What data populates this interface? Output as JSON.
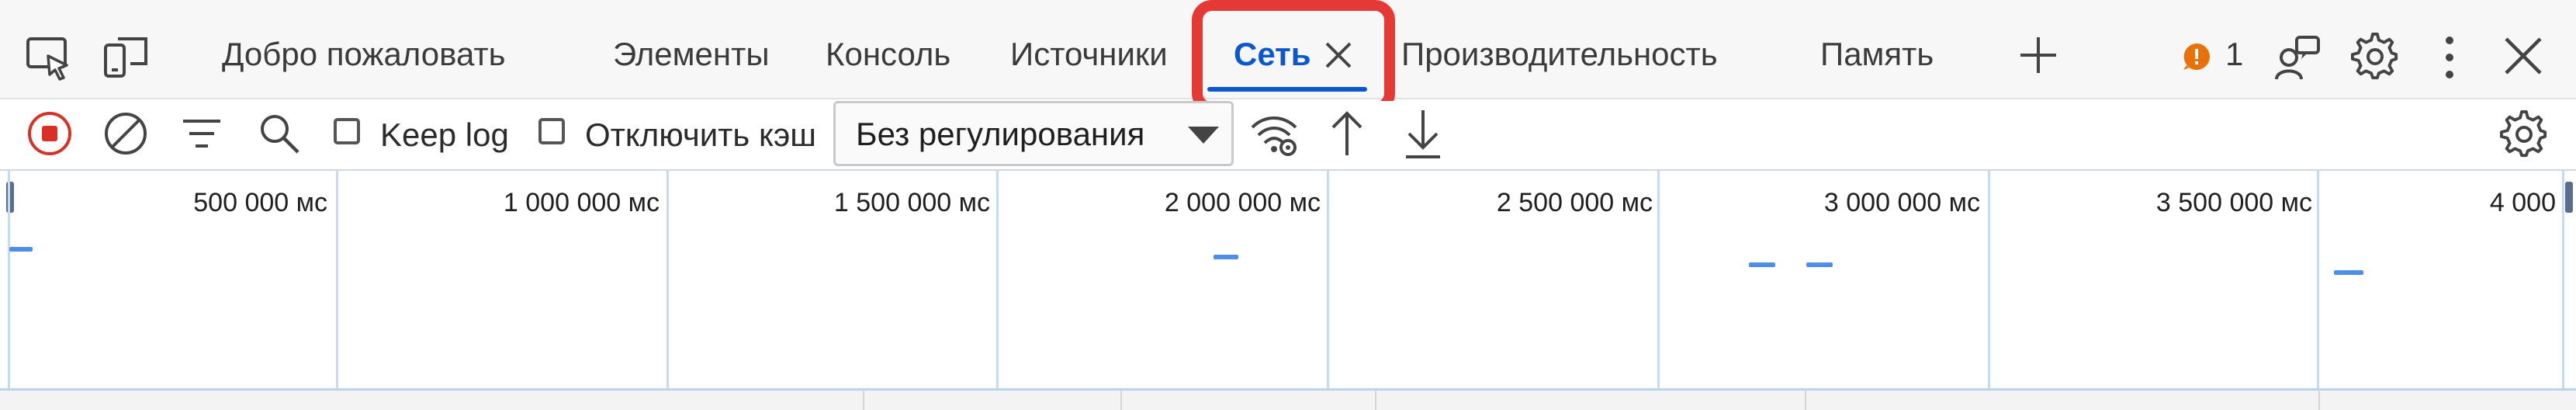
{
  "tabs": {
    "welcome": "Добро пожаловать",
    "elements": "Элементы",
    "console": "Консоль",
    "sources": "Источники",
    "network": "Сеть",
    "performance": "Производительность",
    "memory": "Память"
  },
  "issues": {
    "count": "1",
    "color": "#e8710a"
  },
  "accent": "#0b57d0",
  "highlight_color": "#e53935",
  "toolbar": {
    "keep_log": "Keep log",
    "disable_cache": "Отключить кэш",
    "throttling_value": "Без регулирования"
  },
  "overview": {
    "ticks": [
      "500 000 мс",
      "1 000 000 мс",
      "1 500 000 мс",
      "2 000 000 мс",
      "2 500 000 мс",
      "3 000 000 мс",
      "3 500 000 мс",
      "4 000"
    ]
  },
  "icons": [
    "inspect-element-icon",
    "device-toolbar-icon",
    "close-tab-icon",
    "add-tab-icon",
    "issues-icon",
    "feedback-icon",
    "settings-icon",
    "more-vert-icon",
    "close-devtools-icon",
    "record-icon",
    "clear-icon",
    "filter-icon",
    "search-icon",
    "network-conditions-icon",
    "import-har-icon",
    "export-har-icon",
    "network-settings-icon"
  ]
}
